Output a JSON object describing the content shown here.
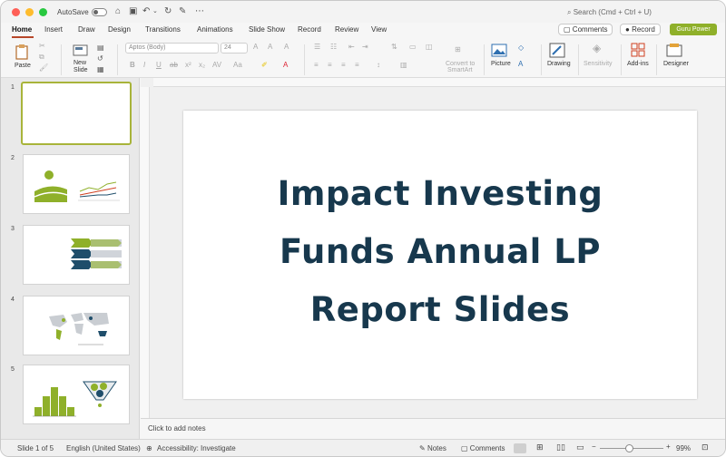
{
  "titlebar": {
    "autosave_label": "AutoSave",
    "search_placeholder": "Search (Cmd + Ctrl + U)"
  },
  "tabs": [
    {
      "label": "Home"
    },
    {
      "label": "Insert"
    },
    {
      "label": "Draw"
    },
    {
      "label": "Design"
    },
    {
      "label": "Transitions"
    },
    {
      "label": "Animations"
    },
    {
      "label": "Slide Show"
    },
    {
      "label": "Record"
    },
    {
      "label": "Review"
    },
    {
      "label": "View"
    }
  ],
  "header_buttons": {
    "comments": "Comments",
    "record": "Record",
    "guru": "Guru Power"
  },
  "ribbon": {
    "paste": "Paste",
    "new_slide_1": "New",
    "new_slide_2": "Slide",
    "font_name": "Aptos (Body)",
    "font_size": "24",
    "convert_1": "Convert to",
    "convert_2": "SmartArt",
    "picture": "Picture",
    "drawing": "Drawing",
    "sensitivity": "Sensitivity",
    "addins": "Add-ins",
    "designer": "Designer"
  },
  "slides": [
    {
      "number": "1"
    },
    {
      "number": "2"
    },
    {
      "number": "3"
    },
    {
      "number": "4"
    },
    {
      "number": "5"
    }
  ],
  "slide": {
    "title_line1": "Impact Investing",
    "title_line2": "Funds Annual LP",
    "title_line3": "Report Slides"
  },
  "notes_placeholder": "Click to add notes",
  "status": {
    "slide_of": "Slide 1 of 5",
    "language": "English (United States)",
    "accessibility": "Accessibility: Investigate",
    "notes": "Notes",
    "comments": "Comments",
    "zoom": "99%"
  },
  "colors": {
    "accent_tab": "#b7472a",
    "title_color": "#17384d",
    "thumb_green": "#8fb02a",
    "thumb_navy": "#1f4e6b"
  }
}
